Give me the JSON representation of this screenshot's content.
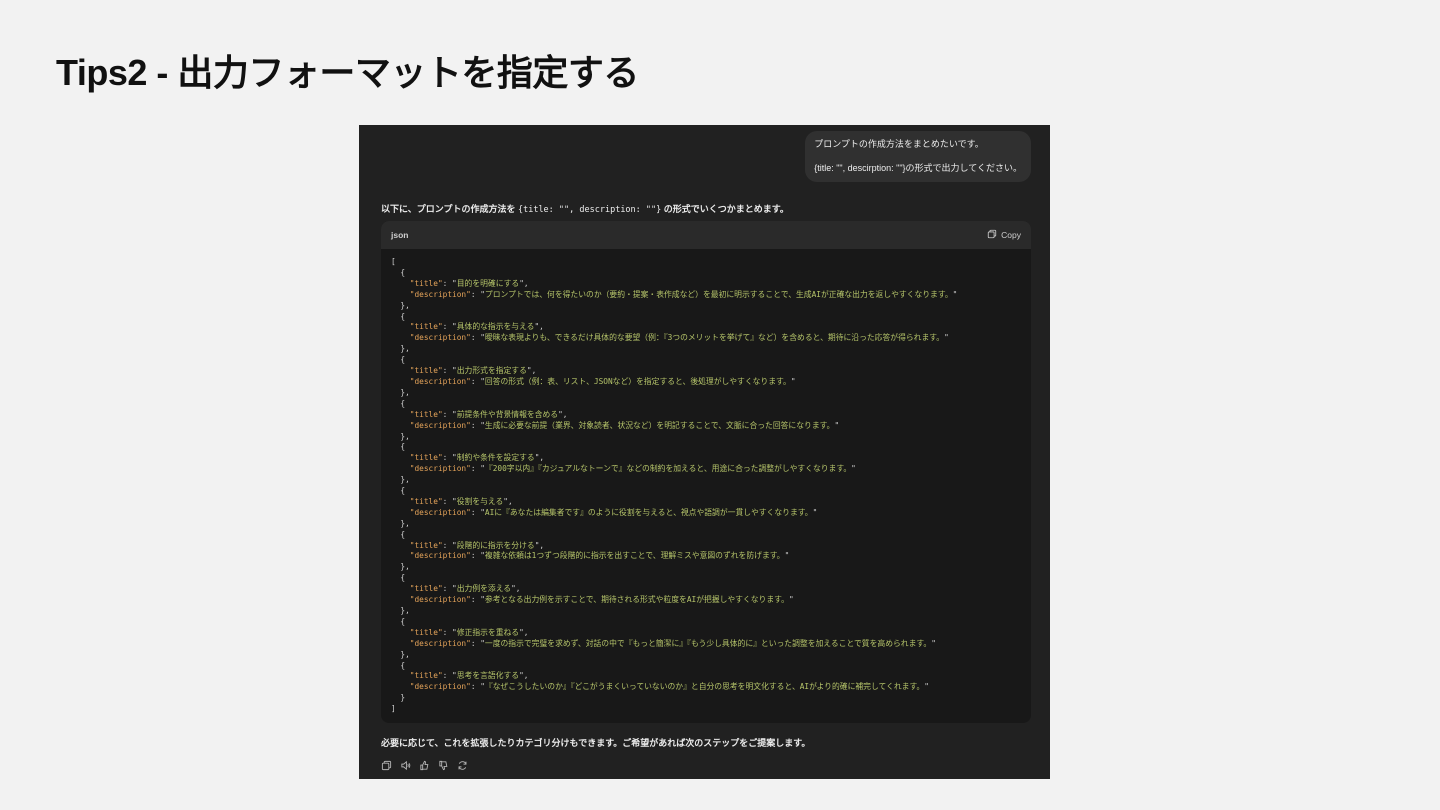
{
  "slide": {
    "title": "Tips2 - 出力フォーマットを指定する"
  },
  "chat": {
    "user_message": {
      "line1": "プロンプトの作成方法をまとめたいです。",
      "line2": "{title: \"\", descirption: \"\"}の形式で出力してください。"
    },
    "assistant_intro": {
      "prefix": "以下に、プロンプトの作成方法を ",
      "code": "{title: \"\", description: \"\"}",
      "suffix": " の形式でいくつかまとめます。"
    },
    "code_block": {
      "language": "json",
      "copy_label": "Copy",
      "items": [
        {
          "title": "目的を明確にする",
          "description": "プロンプトでは、何を得たいのか（要約・提案・表作成など）を最初に明示することで、生成AIが正確な出力を返しやすくなります。"
        },
        {
          "title": "具体的な指示を与える",
          "description": "曖昧な表現よりも、できるだけ具体的な要望（例：『3つのメリットを挙げて』など）を含めると、期待に沿った応答が得られます。"
        },
        {
          "title": "出力形式を指定する",
          "description": "回答の形式（例：表、リスト、JSONなど）を指定すると、後処理がしやすくなります。"
        },
        {
          "title": "前提条件や背景情報を含める",
          "description": "生成に必要な前提（業界、対象読者、状況など）を明記することで、文脈に合った回答になります。"
        },
        {
          "title": "制約や条件を設定する",
          "description": "『200字以内』『カジュアルなトーンで』などの制約を加えると、用途に合った調整がしやすくなります。"
        },
        {
          "title": "役割を与える",
          "description": "AIに『あなたは編集者です』のように役割を与えると、視点や語調が一貫しやすくなります。"
        },
        {
          "title": "段階的に指示を分ける",
          "description": "複雑な依頼は1つずつ段階的に指示を出すことで、理解ミスや意図のずれを防げます。"
        },
        {
          "title": "出力例を添える",
          "description": "参考となる出力例を示すことで、期待される形式や粒度をAIが把握しやすくなります。"
        },
        {
          "title": "修正指示を重ねる",
          "description": "一度の指示で完璧を求めず、対話の中で『もっと簡潔に』『もう少し具体的に』といった調整を加えることで質を高められます。"
        },
        {
          "title": "思考を言語化する",
          "description": "『なぜこうしたいのか』『どこがうまくいっていないのか』と自分の思考を明文化すると、AIがより的確に補完してくれます。"
        }
      ]
    },
    "assistant_outro": "必要に応じて、これを拡張したりカテゴリ分けもできます。ご希望があれば次のステップをご提案します。",
    "actions": [
      "copy-icon",
      "speaker-icon",
      "thumbs-up-icon",
      "thumbs-down-icon",
      "regenerate-icon"
    ]
  }
}
